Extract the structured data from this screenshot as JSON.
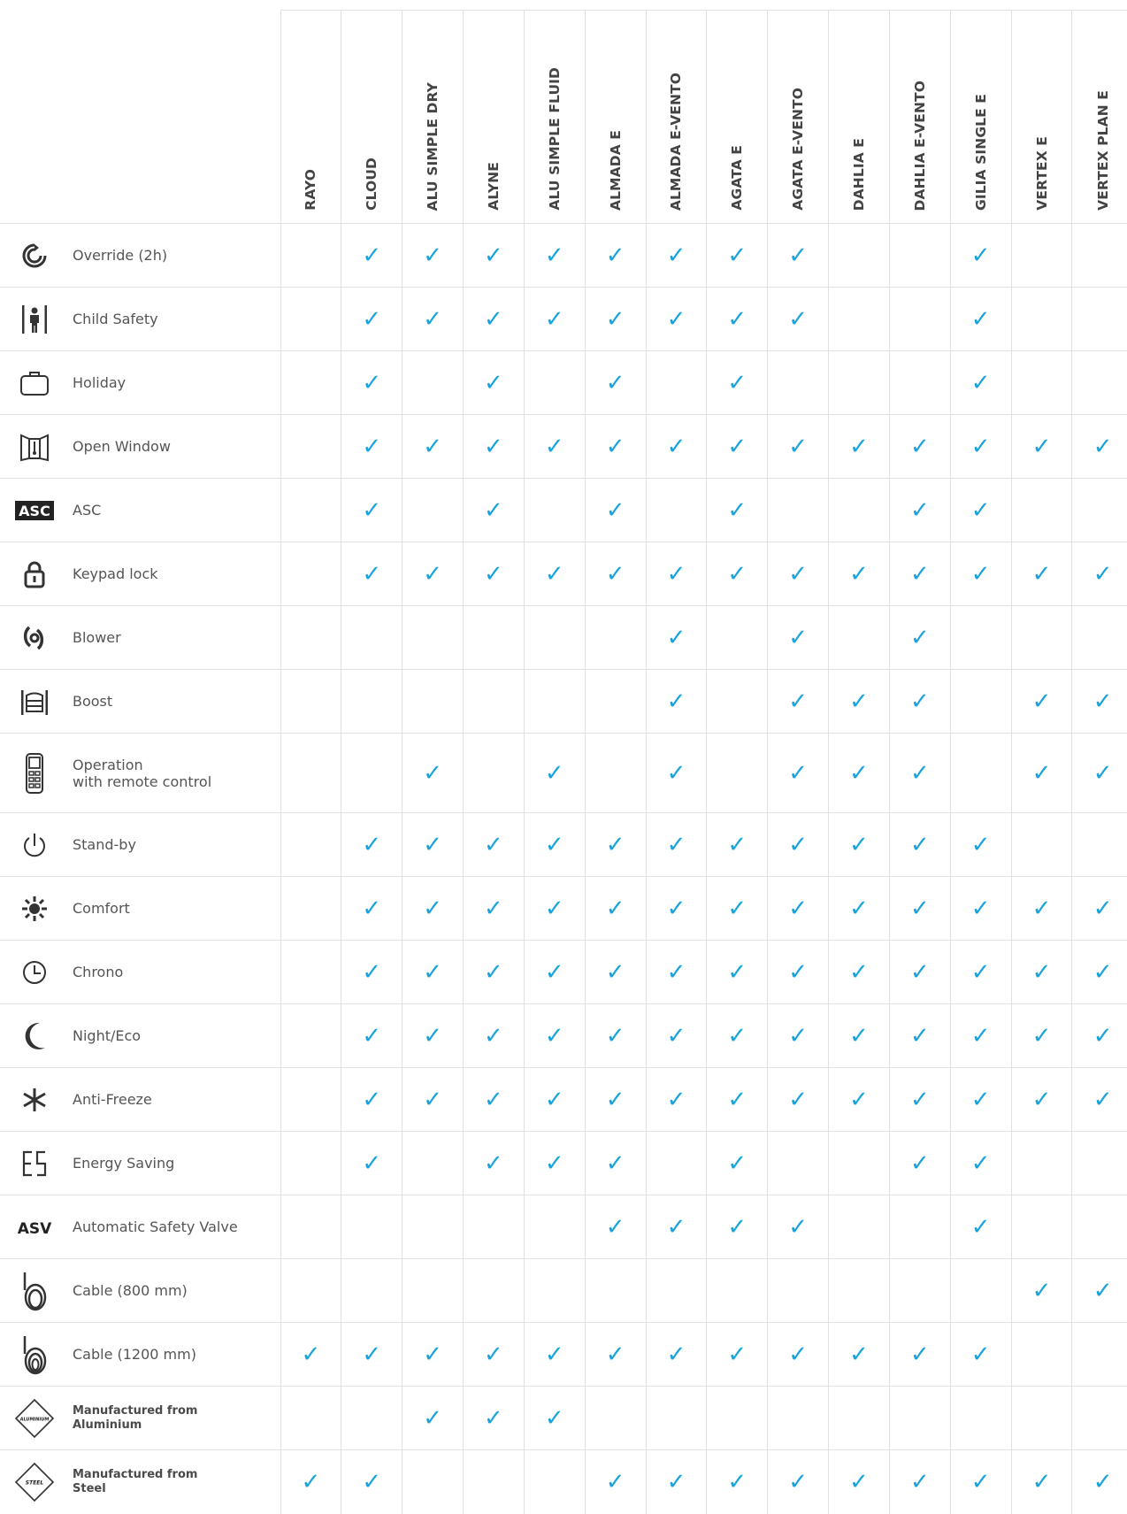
{
  "products": [
    "RAYO",
    "CLOUD",
    "ALU SIMPLE DRY",
    "ALYNE",
    "ALU SIMPLE FLUID",
    "ALMADA E",
    "ALMADA E-VENTO",
    "AGATA E",
    "AGATA E-VENTO",
    "DAHLIA E",
    "DAHLIA E-VENTO",
    "GILIA SINGLE E",
    "VERTEX E",
    "VERTEX PLAN E"
  ],
  "check_symbol": "✓",
  "check_color": "#1aa3dd",
  "features": [
    {
      "label": "Override (2h)",
      "icon": "override-icon",
      "checks": [
        0,
        1,
        1,
        1,
        1,
        1,
        1,
        1,
        1,
        0,
        0,
        1,
        0,
        0
      ]
    },
    {
      "label": "Child Safety",
      "icon": "child-safety-icon",
      "checks": [
        0,
        1,
        1,
        1,
        1,
        1,
        1,
        1,
        1,
        0,
        0,
        1,
        0,
        0
      ]
    },
    {
      "label": "Holiday",
      "icon": "suitcase-icon",
      "checks": [
        0,
        1,
        0,
        1,
        0,
        1,
        0,
        1,
        0,
        0,
        0,
        1,
        0,
        0
      ]
    },
    {
      "label": "Open Window",
      "icon": "open-window-icon",
      "checks": [
        0,
        1,
        1,
        1,
        1,
        1,
        1,
        1,
        1,
        1,
        1,
        1,
        1,
        1
      ]
    },
    {
      "label": "ASC",
      "icon": "asc-icon",
      "icon_text": "ASC",
      "checks": [
        0,
        1,
        0,
        1,
        0,
        1,
        0,
        1,
        0,
        0,
        1,
        1,
        0,
        0
      ]
    },
    {
      "label": "Keypad lock",
      "icon": "padlock-icon",
      "checks": [
        0,
        1,
        1,
        1,
        1,
        1,
        1,
        1,
        1,
        1,
        1,
        1,
        1,
        1
      ]
    },
    {
      "label": "Blower",
      "icon": "blower-icon",
      "checks": [
        0,
        0,
        0,
        0,
        0,
        0,
        1,
        0,
        1,
        0,
        1,
        0,
        0,
        0
      ]
    },
    {
      "label": "Boost",
      "icon": "boost-icon",
      "checks": [
        0,
        0,
        0,
        0,
        0,
        0,
        1,
        0,
        1,
        1,
        1,
        0,
        1,
        1
      ]
    },
    {
      "label": "Operation\nwith remote control",
      "icon": "remote-control-icon",
      "checks": [
        0,
        0,
        1,
        0,
        1,
        0,
        1,
        0,
        1,
        1,
        1,
        0,
        1,
        1
      ]
    },
    {
      "label": "Stand-by",
      "icon": "power-icon",
      "checks": [
        0,
        1,
        1,
        1,
        1,
        1,
        1,
        1,
        1,
        1,
        1,
        1,
        0,
        0
      ]
    },
    {
      "label": "Comfort",
      "icon": "sun-icon",
      "checks": [
        0,
        1,
        1,
        1,
        1,
        1,
        1,
        1,
        1,
        1,
        1,
        1,
        1,
        1
      ]
    },
    {
      "label": "Chrono",
      "icon": "clock-icon",
      "checks": [
        0,
        1,
        1,
        1,
        1,
        1,
        1,
        1,
        1,
        1,
        1,
        1,
        1,
        1
      ]
    },
    {
      "label": "Night/Eco",
      "icon": "moon-icon",
      "checks": [
        0,
        1,
        1,
        1,
        1,
        1,
        1,
        1,
        1,
        1,
        1,
        1,
        1,
        1
      ]
    },
    {
      "label": "Anti-Freeze",
      "icon": "snowflake-icon",
      "checks": [
        0,
        1,
        1,
        1,
        1,
        1,
        1,
        1,
        1,
        1,
        1,
        1,
        1,
        1
      ]
    },
    {
      "label": "Energy Saving",
      "icon": "energy-saving-icon",
      "checks": [
        0,
        1,
        0,
        1,
        1,
        1,
        0,
        1,
        0,
        0,
        1,
        1,
        0,
        0
      ]
    },
    {
      "label": "Automatic Safety Valve",
      "icon": "asv-icon",
      "icon_text": "ASV",
      "checks": [
        0,
        0,
        0,
        0,
        0,
        1,
        1,
        1,
        1,
        0,
        0,
        1,
        0,
        0
      ]
    },
    {
      "label": "Cable (800 mm)",
      "icon": "cable-800-icon",
      "checks": [
        0,
        0,
        0,
        0,
        0,
        0,
        0,
        0,
        0,
        0,
        0,
        0,
        1,
        1
      ]
    },
    {
      "label": "Cable (1200 mm)",
      "icon": "cable-1200-icon",
      "checks": [
        1,
        1,
        1,
        1,
        1,
        1,
        1,
        1,
        1,
        1,
        1,
        1,
        0,
        0
      ]
    },
    {
      "label": "Manufactured from\nAluminium",
      "icon": "aluminium-badge-icon",
      "icon_text": "ALUMINIUM",
      "checks": [
        0,
        0,
        1,
        1,
        1,
        0,
        0,
        0,
        0,
        0,
        0,
        0,
        0,
        0
      ]
    },
    {
      "label": "Manufactured from\nSteel",
      "icon": "steel-badge-icon",
      "icon_text": "STEEL",
      "checks": [
        1,
        1,
        0,
        0,
        0,
        1,
        1,
        1,
        1,
        1,
        1,
        1,
        1,
        1
      ]
    }
  ]
}
